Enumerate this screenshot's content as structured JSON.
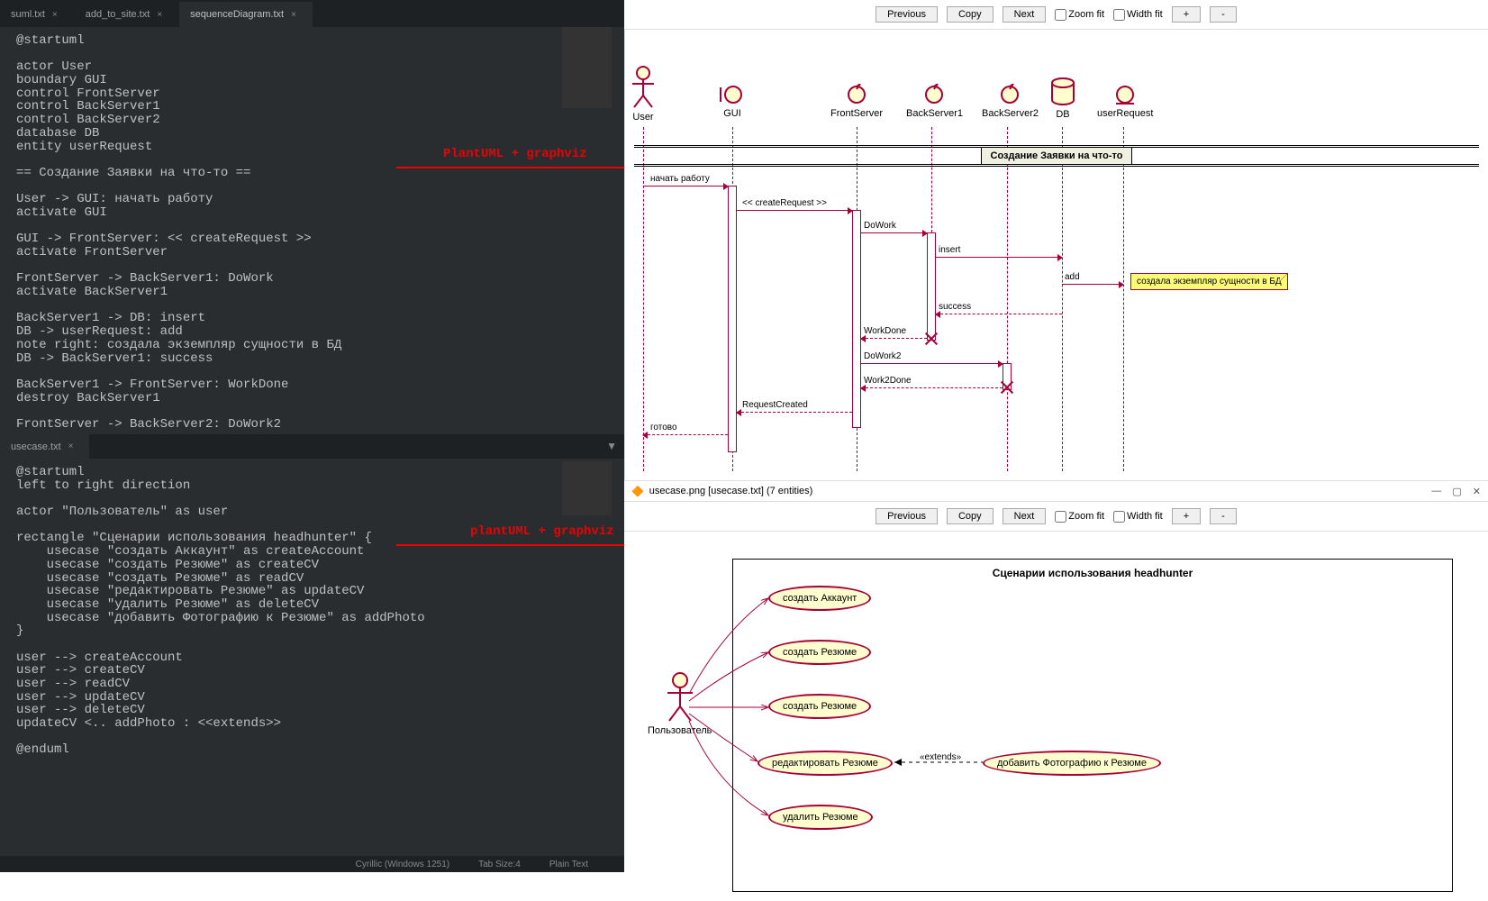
{
  "tabs_top": [
    {
      "label": "suml.txt",
      "active": false
    },
    {
      "label": "add_to_site.txt",
      "active": false
    },
    {
      "label": "sequenceDiagram.txt",
      "active": true
    }
  ],
  "tabs_mid": [
    {
      "label": "usecase.txt",
      "active": true
    }
  ],
  "editor1_text": "@startuml\n\nactor User\nboundary GUI\ncontrol FrontServer\ncontrol BackServer1\ncontrol BackServer2\ndatabase DB\nentity userRequest\n\n== Создание Заявки на что-то ==\n\nUser -> GUI: начать работу\nactivate GUI\n\nGUI -> FrontServer: << createRequest >>\nactivate FrontServer\n\nFrontServer -> BackServer1: DoWork\nactivate BackServer1\n\nBackServer1 -> DB: insert\nDB -> userRequest: add\nnote right: создала экземпляр сущности в БД\nDB -> BackServer1: success\n\nBackServer1 -> FrontServer: WorkDone\ndestroy BackServer1\n\nFrontServer -> BackServer2: DoWork2",
  "editor2_text": "@startuml\nleft to right direction\n\nactor \"Пользователь\" as user\n\nrectangle \"Сценарии использования headhunter\" {\n    usecase \"создать Аккаунт\" as createAccount\n    usecase \"создать Резюме\" as createCV\n    usecase \"создать Резюме\" as readCV\n    usecase \"редактировать Резюме\" as updateCV\n    usecase \"удалить Резюме\" as deleteCV\n    usecase \"добавить Фотографию к Резюме\" as addPhoto\n}\n\nuser --> createAccount\nuser --> createCV\nuser --> readCV\nuser --> updateCV\nuser --> deleteCV\nupdateCV <.. addPhoto : <<extends>>\n\n@enduml",
  "statusbar": {
    "encoding": "Cyrillic (Windows 1251)",
    "tabsize": "Tab Size:4",
    "syntax": "Plain Text"
  },
  "toolbar": {
    "prev": "Previous",
    "copy": "Copy",
    "next": "Next",
    "zoom": "Zoom fit",
    "width": "Width fit",
    "plus": "+",
    "minus": "-"
  },
  "seq": {
    "title": "Создание Заявки на что-то",
    "participants": [
      "User",
      "GUI",
      "FrontServer",
      "BackServer1",
      "BackServer2",
      "DB",
      "userRequest"
    ],
    "msgs": {
      "m1": "начать работу",
      "m2": "<< createRequest >>",
      "m3": "DoWork",
      "m4": "insert",
      "m5": "add",
      "m6": "success",
      "m7": "WorkDone",
      "m8": "DoWork2",
      "m9": "Work2Done",
      "m10": "RequestCreated",
      "m11": "готово"
    },
    "note": "создала экземпляр сущности в БД"
  },
  "window2_title": "usecase.png [usecase.txt] (7 entities)",
  "uc": {
    "title": "Сценарии использования headhunter",
    "actor": "Пользователь",
    "cases": {
      "c1": "создать Аккаунт",
      "c2": "создать Резюме",
      "c3": "создать Резюме",
      "c4": "редактировать Резюме",
      "c5": "удалить Резюме",
      "c6": "добавить Фотографию к Резюме"
    },
    "ext": "«extends»"
  },
  "annotations": {
    "a1": "PlantUML + graphviz",
    "a2": "plantUML + graphviz"
  },
  "chart_data": {
    "type": "diagram",
    "sequence": {
      "title": "Создание Заявки на что-то",
      "participants": [
        {
          "name": "User",
          "type": "actor"
        },
        {
          "name": "GUI",
          "type": "boundary"
        },
        {
          "name": "FrontServer",
          "type": "control"
        },
        {
          "name": "BackServer1",
          "type": "control"
        },
        {
          "name": "BackServer2",
          "type": "control"
        },
        {
          "name": "DB",
          "type": "database"
        },
        {
          "name": "userRequest",
          "type": "entity"
        }
      ],
      "messages": [
        {
          "from": "User",
          "to": "GUI",
          "label": "начать работу",
          "activate": "GUI"
        },
        {
          "from": "GUI",
          "to": "FrontServer",
          "label": "<< createRequest >>",
          "activate": "FrontServer"
        },
        {
          "from": "FrontServer",
          "to": "BackServer1",
          "label": "DoWork",
          "activate": "BackServer1"
        },
        {
          "from": "BackServer1",
          "to": "DB",
          "label": "insert"
        },
        {
          "from": "DB",
          "to": "userRequest",
          "label": "add",
          "note": "создала экземпляр сущности в БД"
        },
        {
          "from": "DB",
          "to": "BackServer1",
          "label": "success",
          "return": true
        },
        {
          "from": "BackServer1",
          "to": "FrontServer",
          "label": "WorkDone",
          "return": true,
          "destroy": "BackServer1"
        },
        {
          "from": "FrontServer",
          "to": "BackServer2",
          "label": "DoWork2",
          "activate": "BackServer2"
        },
        {
          "from": "BackServer2",
          "to": "FrontServer",
          "label": "Work2Done",
          "return": true,
          "destroy": "BackServer2"
        },
        {
          "from": "FrontServer",
          "to": "GUI",
          "label": "RequestCreated",
          "return": true
        },
        {
          "from": "GUI",
          "to": "User",
          "label": "готово",
          "return": true
        }
      ]
    },
    "usecase": {
      "title": "Сценарии использования headhunter",
      "actors": [
        "Пользователь"
      ],
      "usecases": [
        "создать Аккаунт",
        "создать Резюме",
        "создать Резюме",
        "редактировать Резюме",
        "удалить Резюме",
        "добавить Фотографию к Резюме"
      ],
      "associations": [
        [
          "Пользователь",
          "создать Аккаунт"
        ],
        [
          "Пользователь",
          "создать Резюме"
        ],
        [
          "Пользователь",
          "создать Резюме"
        ],
        [
          "Пользователь",
          "редактировать Резюме"
        ],
        [
          "Пользователь",
          "удалить Резюме"
        ]
      ],
      "extensions": [
        {
          "from": "добавить Фотографию к Резюме",
          "to": "редактировать Резюме",
          "label": "<<extends>>"
        }
      ]
    }
  }
}
